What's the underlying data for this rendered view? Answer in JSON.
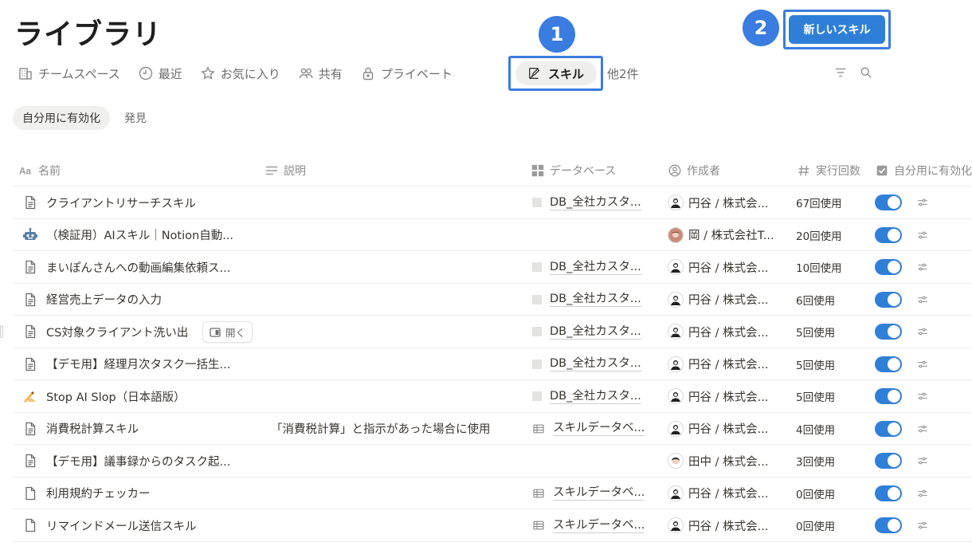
{
  "page": {
    "title": "ライブラリ"
  },
  "callouts": {
    "one": "1",
    "two": "2"
  },
  "header": {
    "new_skill_label": "新しいスキル"
  },
  "tabs": [
    {
      "label": "チームスペース",
      "icon": "building-icon"
    },
    {
      "label": "最近",
      "icon": "clock-icon"
    },
    {
      "label": "お気に入り",
      "icon": "star-icon"
    },
    {
      "label": "共有",
      "icon": "people-icon"
    },
    {
      "label": "プライベート",
      "icon": "lock-icon"
    }
  ],
  "active_tab": {
    "label": "スキル",
    "icon": "skill-edit-icon"
  },
  "more_tabs": "他2件",
  "filters": {
    "enabled_label": "自分用に有効化",
    "discover_label": "発見"
  },
  "columns": {
    "name": "名前",
    "description": "説明",
    "database": "データベース",
    "author": "作成者",
    "uses": "実行回数",
    "enabled": "自分用に有効化"
  },
  "hover_chip": {
    "label": "開く"
  },
  "colors": {
    "accent": "#2f7fd6",
    "callout": "#3b7ce0"
  },
  "rows": [
    {
      "icon": "page-icon",
      "name": "クライアントリサーチスキル",
      "description": "",
      "database": "DB_全社カスタ...",
      "db_icon": "square",
      "author": "円谷 / 株式会...",
      "uses": "67回使用",
      "enabled": true
    },
    {
      "icon": "robot-icon",
      "name": "（検証用）AIスキル｜Notion自動...",
      "description": "",
      "database": "",
      "db_icon": "",
      "author": "岡 / 株式会社T...",
      "uses": "20回使用",
      "enabled": true
    },
    {
      "icon": "page-icon",
      "name": "まいぽんさんへの動画編集依頼ス...",
      "description": "",
      "database": "DB_全社カスタ...",
      "db_icon": "square",
      "author": "円谷 / 株式会...",
      "uses": "10回使用",
      "enabled": true
    },
    {
      "icon": "page-icon",
      "name": "経営売上データの入力",
      "description": "",
      "database": "DB_全社カスタ...",
      "db_icon": "square",
      "author": "円谷 / 株式会...",
      "uses": "6回使用",
      "enabled": true
    },
    {
      "icon": "page-icon",
      "name": "CS対象クライアント洗い出",
      "description": "",
      "database": "DB_全社カスタ...",
      "db_icon": "square",
      "author": "円谷 / 株式会...",
      "uses": "5回使用",
      "enabled": true
    },
    {
      "icon": "page-icon",
      "name": "【デモ用】経理月次タスク一括生...",
      "description": "",
      "database": "DB_全社カスタ...",
      "db_icon": "square",
      "author": "円谷 / 株式会...",
      "uses": "5回使用",
      "enabled": true
    },
    {
      "icon": "writing-hand-icon",
      "name": "Stop AI Slop（日本語版）",
      "description": "",
      "database": "DB_全社カスタ...",
      "db_icon": "square",
      "author": "円谷 / 株式会...",
      "uses": "5回使用",
      "enabled": true
    },
    {
      "icon": "page-icon",
      "name": "消費税計算スキル",
      "description": "「消費税計算」と指示があった場合に使用",
      "database": "スキルデータベ...",
      "db_icon": "table",
      "author": "円谷 / 株式会...",
      "uses": "4回使用",
      "enabled": true
    },
    {
      "icon": "page-icon",
      "name": "【デモ用】議事録からのタスク起...",
      "description": "",
      "database": "",
      "db_icon": "",
      "author": "田中 / 株式会...",
      "uses": "3回使用",
      "enabled": true
    },
    {
      "icon": "blank-page-icon",
      "name": "利用規約チェッカー",
      "description": "",
      "database": "スキルデータベ...",
      "db_icon": "table",
      "author": "円谷 / 株式会...",
      "uses": "0回使用",
      "enabled": true
    },
    {
      "icon": "blank-page-icon",
      "name": "リマインドメール送信スキル",
      "description": "",
      "database": "スキルデータベ...",
      "db_icon": "table",
      "author": "円谷 / 株式会...",
      "uses": "0回使用",
      "enabled": true
    }
  ]
}
